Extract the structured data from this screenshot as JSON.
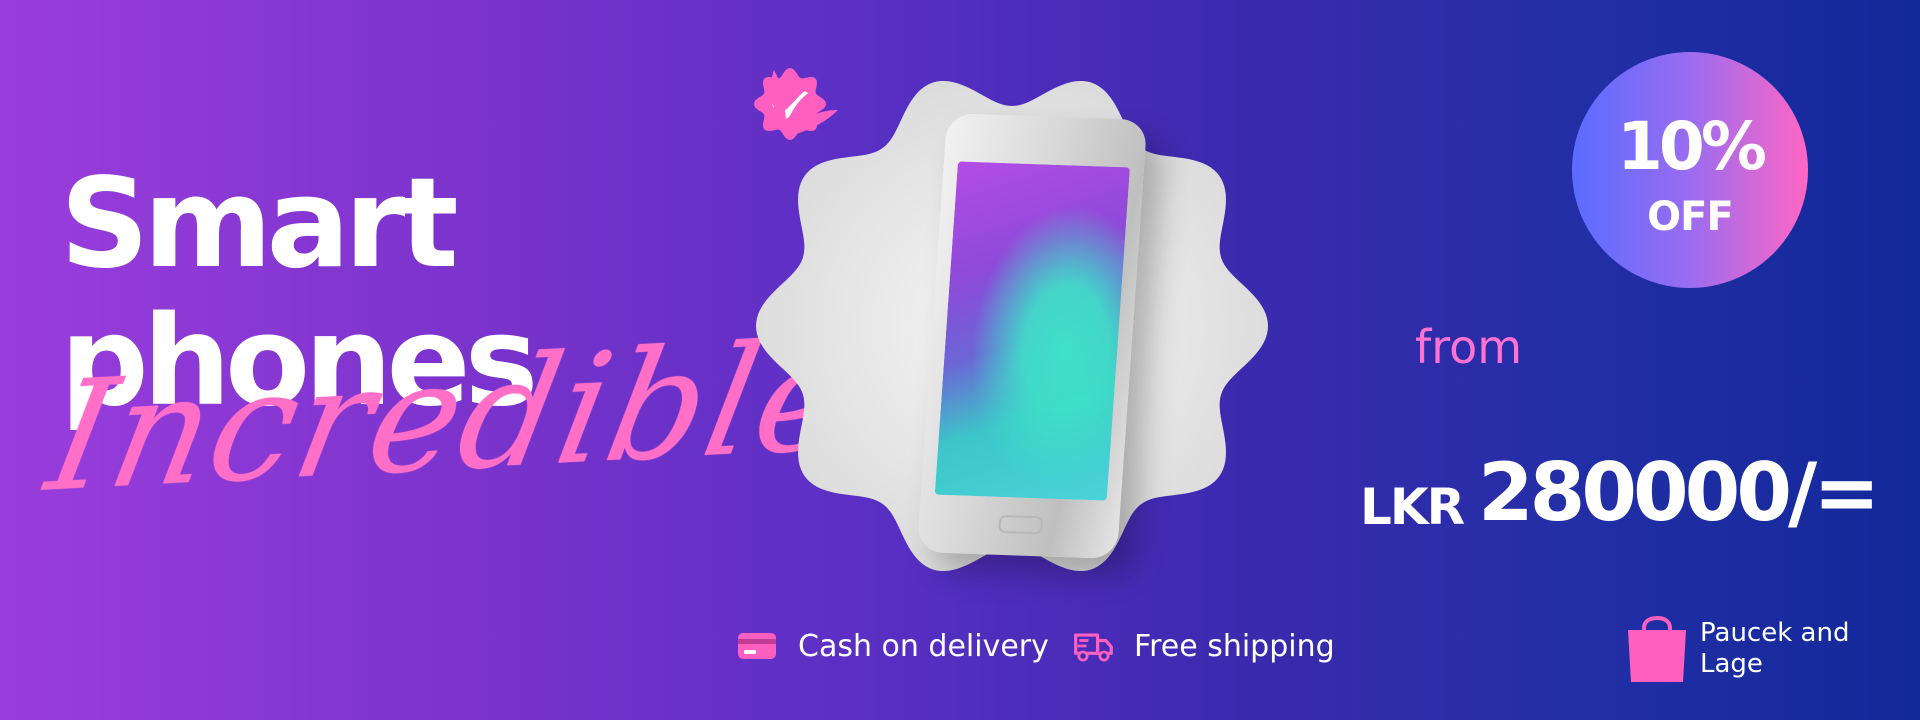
{
  "headline": {
    "line1": "Smart",
    "line2": "phones",
    "script": "Incredibles"
  },
  "discount": {
    "percent": "10%",
    "label": "OFF"
  },
  "price": {
    "prefix": "from",
    "currency": "LKR",
    "amount": "280000/="
  },
  "features": [
    {
      "icon": "credit-card-icon",
      "label": "Cash on delivery"
    },
    {
      "icon": "delivery-truck-icon",
      "label": "Free shipping"
    }
  ],
  "store": {
    "icon": "shopping-bag-icon",
    "name": "Paucek and Lage"
  },
  "colors": {
    "accent_pink": "#ff66c4",
    "background_left": "#9a3ddc",
    "background_right": "#12299a"
  }
}
